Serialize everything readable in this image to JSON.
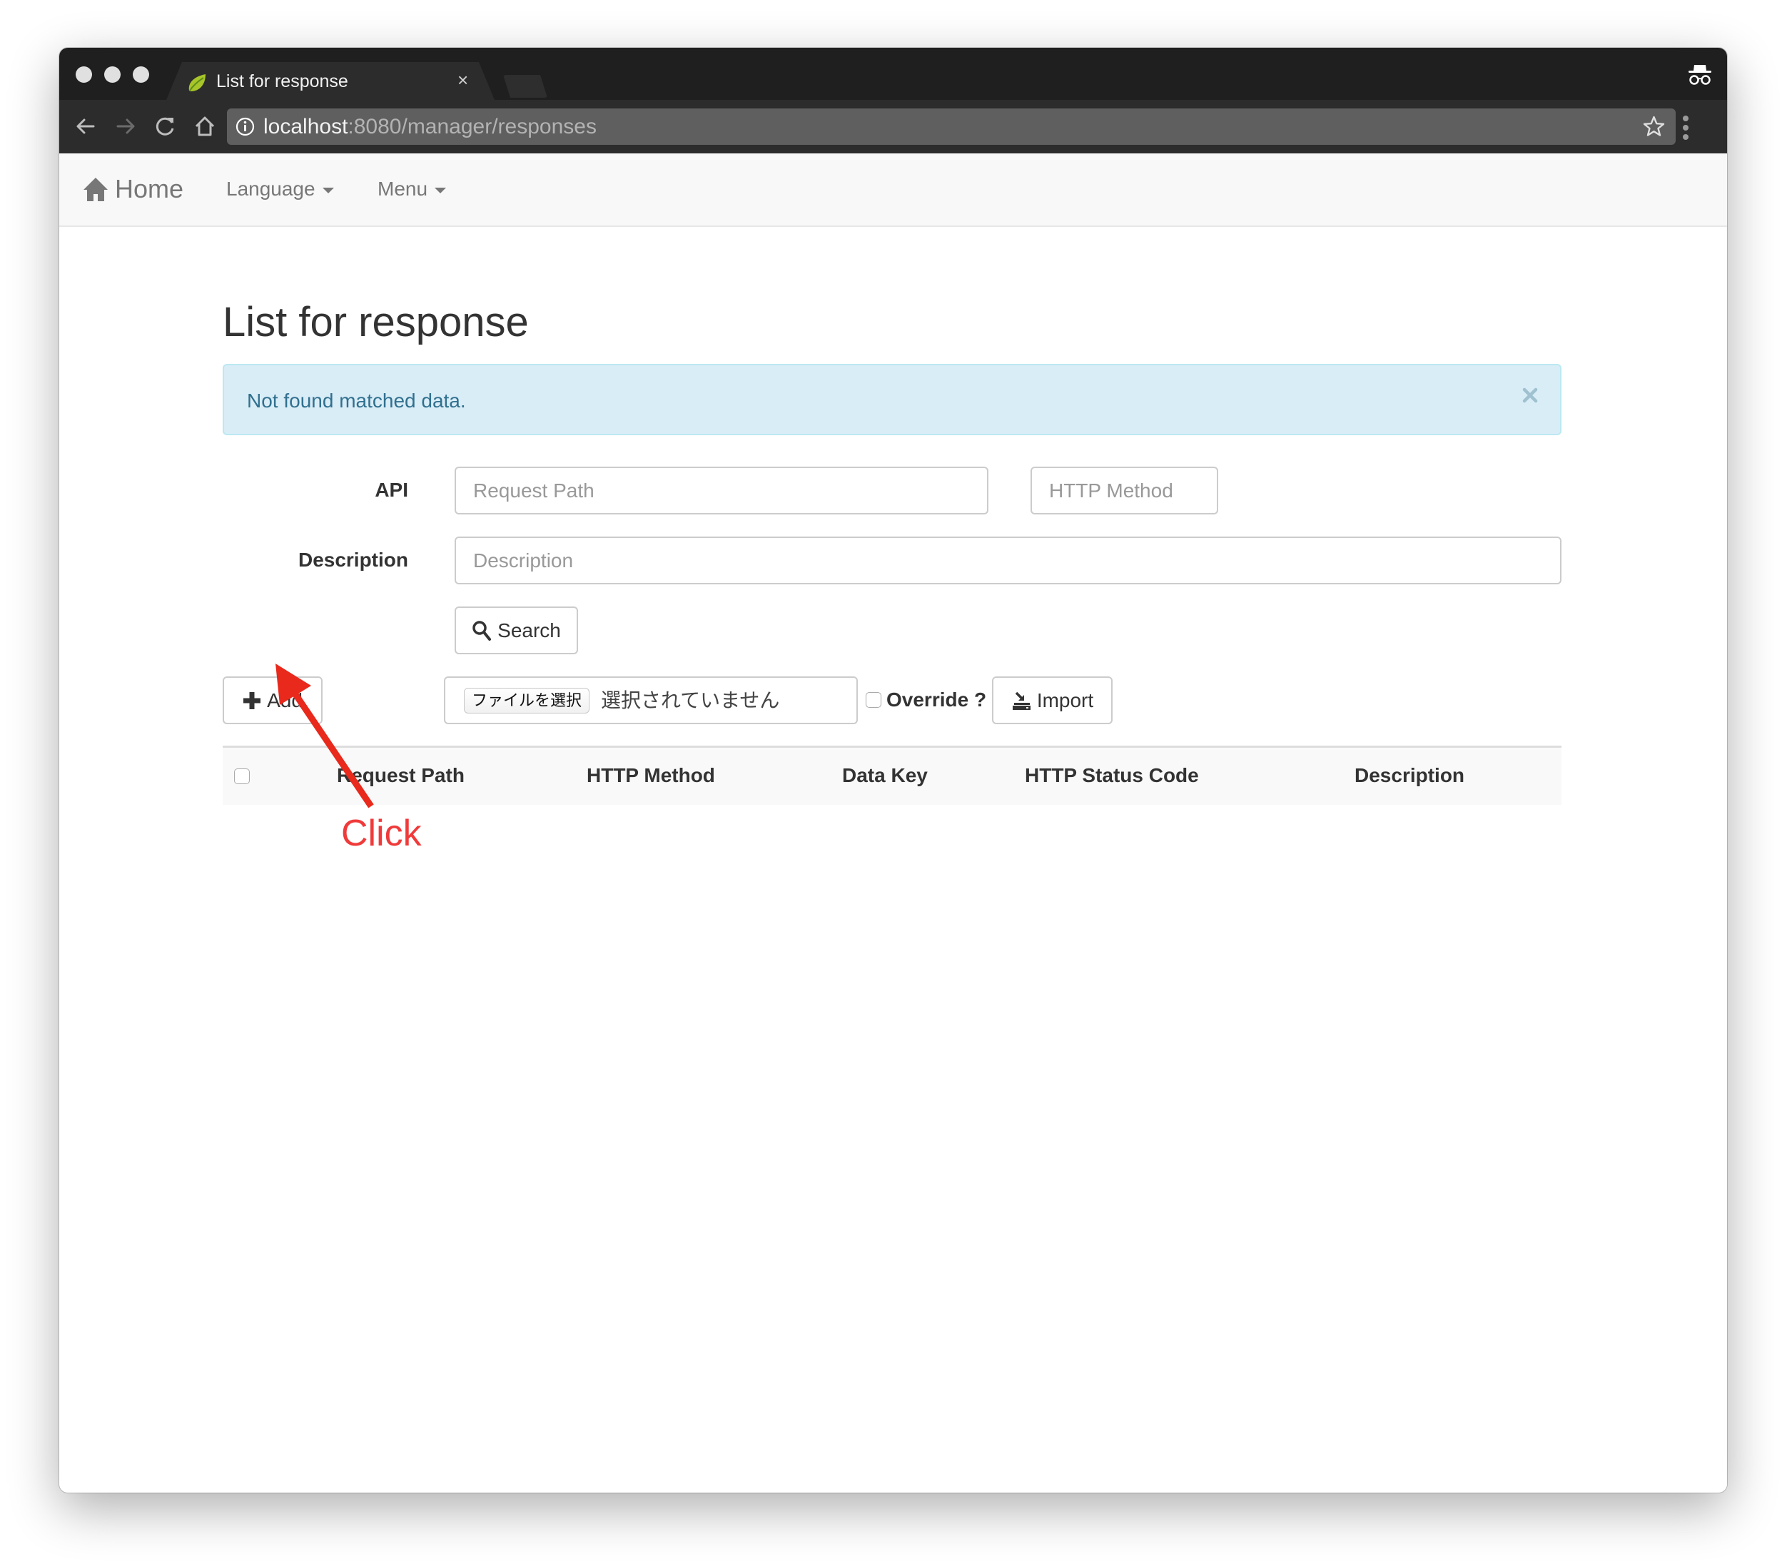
{
  "browser": {
    "tab_title": "List for response",
    "tab_close": "×",
    "url_host": "localhost",
    "url_path": ":8080/manager/responses",
    "icons": {
      "favicon": "spring-leaf-icon",
      "incognito": "incognito-icon",
      "back": "arrow-left-icon",
      "forward": "arrow-right-icon",
      "reload": "reload-icon",
      "home": "home-icon",
      "site_info": "info-icon",
      "bookmark": "star-icon",
      "menu": "kebab-menu-icon"
    }
  },
  "navbar": {
    "brand": "Home",
    "items": [
      {
        "label": "Language"
      },
      {
        "label": "Menu"
      }
    ]
  },
  "page": {
    "title": "List for response",
    "alert": {
      "message": "Not found matched data.",
      "close": "×"
    },
    "form": {
      "api_label": "API",
      "request_path_placeholder": "Request Path",
      "http_method_placeholder": "HTTP Method",
      "description_label": "Description",
      "description_placeholder": "Description",
      "search_label": "Search"
    },
    "actions": {
      "add_label": "Add",
      "file_choose_label": "ファイルを選択",
      "file_status": "選択されていません",
      "override_label": "Override ?",
      "override_checked": false,
      "import_label": "Import"
    },
    "table": {
      "select_all_checked": false,
      "columns": [
        "Request Path",
        "HTTP Method",
        "Data Key",
        "HTTP Status Code",
        "Description"
      ],
      "rows": []
    }
  },
  "annotation": {
    "text": "Click",
    "color": "#e8291c",
    "text_color": "#f03a3a"
  },
  "colors": {
    "alert_bg": "#d9edf7",
    "alert_border": "#bce8f1",
    "alert_text": "#31708f",
    "navbar_bg": "#f8f8f8",
    "titlebar_bg": "#1f1f1f",
    "toolbar_bg": "#2c2c2c",
    "omnibox_bg": "#5f5f5f"
  }
}
